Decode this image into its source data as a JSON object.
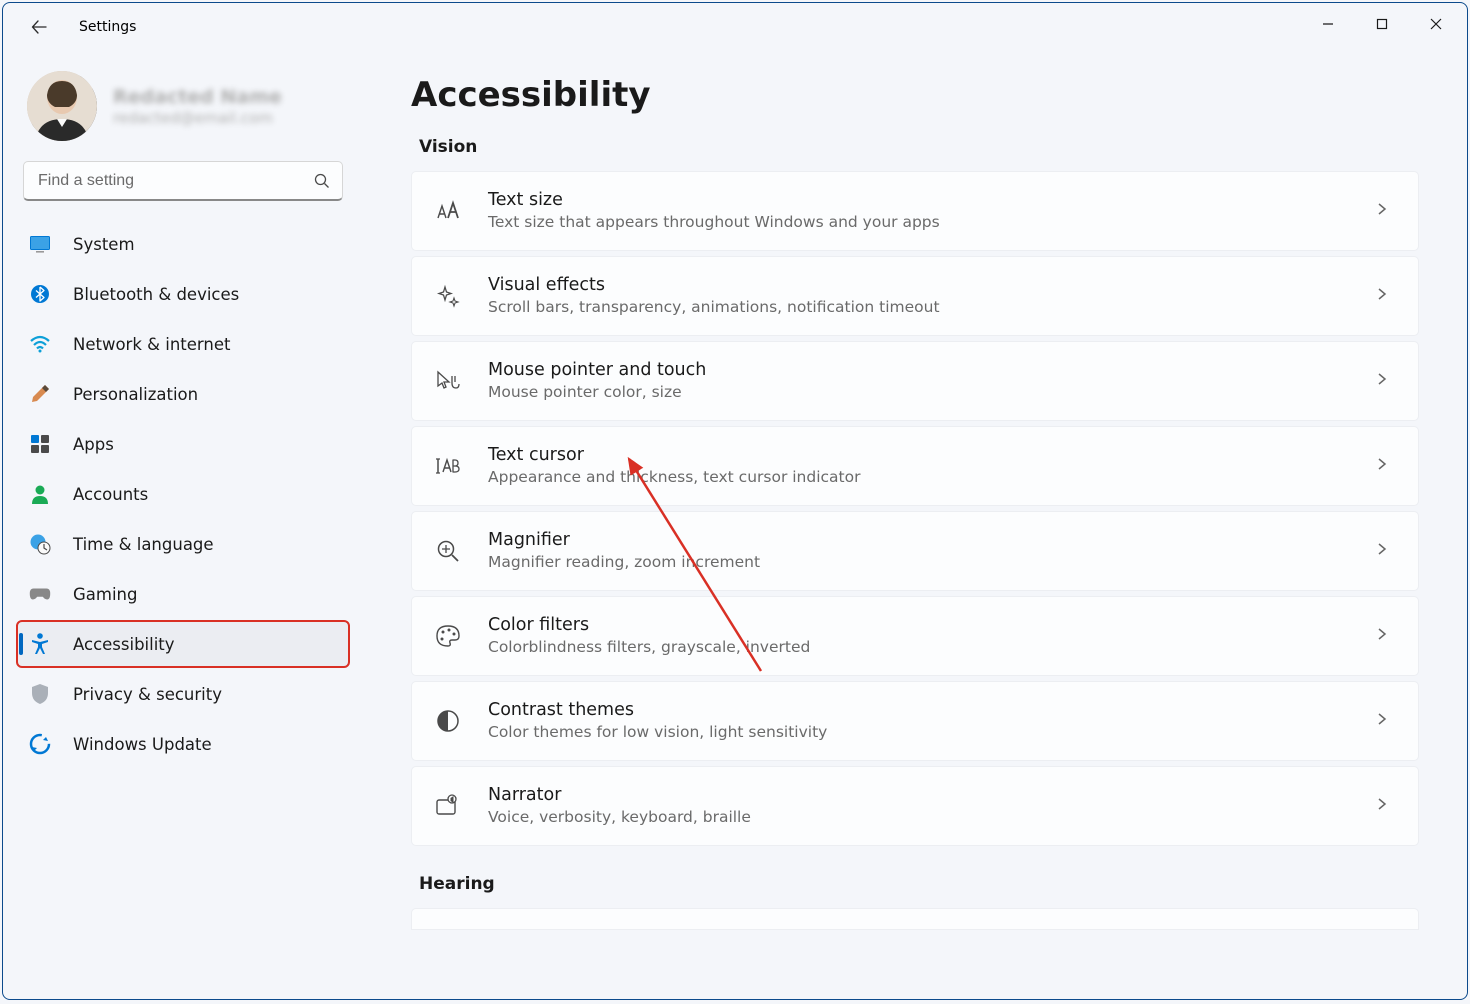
{
  "app": {
    "title": "Settings"
  },
  "user": {
    "name": "Redacted Name",
    "email": "redacted@email.com"
  },
  "search": {
    "placeholder": "Find a setting"
  },
  "nav": [
    {
      "id": "system",
      "label": "System"
    },
    {
      "id": "bluetooth",
      "label": "Bluetooth & devices"
    },
    {
      "id": "network",
      "label": "Network & internet"
    },
    {
      "id": "personalization",
      "label": "Personalization"
    },
    {
      "id": "apps",
      "label": "Apps"
    },
    {
      "id": "accounts",
      "label": "Accounts"
    },
    {
      "id": "time",
      "label": "Time & language"
    },
    {
      "id": "gaming",
      "label": "Gaming"
    },
    {
      "id": "accessibility",
      "label": "Accessibility",
      "active": true,
      "highlighted": true
    },
    {
      "id": "privacy",
      "label": "Privacy & security"
    },
    {
      "id": "update",
      "label": "Windows Update"
    }
  ],
  "page": {
    "title": "Accessibility",
    "sections": [
      {
        "label": "Vision",
        "items": [
          {
            "icon": "text-size",
            "title": "Text size",
            "sub": "Text size that appears throughout Windows and your apps"
          },
          {
            "icon": "sparkle",
            "title": "Visual effects",
            "sub": "Scroll bars, transparency, animations, notification timeout"
          },
          {
            "icon": "pointer",
            "title": "Mouse pointer and touch",
            "sub": "Mouse pointer color, size"
          },
          {
            "icon": "cursor",
            "title": "Text cursor",
            "sub": "Appearance and thickness, text cursor indicator"
          },
          {
            "icon": "magnifier",
            "title": "Magnifier",
            "sub": "Magnifier reading, zoom increment"
          },
          {
            "icon": "palette",
            "title": "Color filters",
            "sub": "Colorblindness filters, grayscale, inverted"
          },
          {
            "icon": "contrast",
            "title": "Contrast themes",
            "sub": "Color themes for low vision, light sensitivity"
          },
          {
            "icon": "narrator",
            "title": "Narrator",
            "sub": "Voice, verbosity, keyboard, braille"
          }
        ]
      },
      {
        "label": "Hearing",
        "items": []
      }
    ]
  }
}
